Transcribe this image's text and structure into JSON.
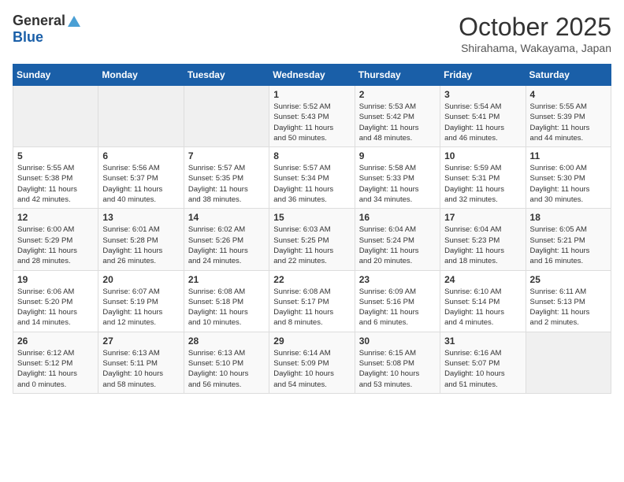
{
  "logo": {
    "general": "General",
    "blue": "Blue"
  },
  "title": "October 2025",
  "location": "Shirahama, Wakayama, Japan",
  "days_of_week": [
    "Sunday",
    "Monday",
    "Tuesday",
    "Wednesday",
    "Thursday",
    "Friday",
    "Saturday"
  ],
  "weeks": [
    [
      {
        "day": "",
        "info": ""
      },
      {
        "day": "",
        "info": ""
      },
      {
        "day": "",
        "info": ""
      },
      {
        "day": "1",
        "info": "Sunrise: 5:52 AM\nSunset: 5:43 PM\nDaylight: 11 hours\nand 50 minutes."
      },
      {
        "day": "2",
        "info": "Sunrise: 5:53 AM\nSunset: 5:42 PM\nDaylight: 11 hours\nand 48 minutes."
      },
      {
        "day": "3",
        "info": "Sunrise: 5:54 AM\nSunset: 5:41 PM\nDaylight: 11 hours\nand 46 minutes."
      },
      {
        "day": "4",
        "info": "Sunrise: 5:55 AM\nSunset: 5:39 PM\nDaylight: 11 hours\nand 44 minutes."
      }
    ],
    [
      {
        "day": "5",
        "info": "Sunrise: 5:55 AM\nSunset: 5:38 PM\nDaylight: 11 hours\nand 42 minutes."
      },
      {
        "day": "6",
        "info": "Sunrise: 5:56 AM\nSunset: 5:37 PM\nDaylight: 11 hours\nand 40 minutes."
      },
      {
        "day": "7",
        "info": "Sunrise: 5:57 AM\nSunset: 5:35 PM\nDaylight: 11 hours\nand 38 minutes."
      },
      {
        "day": "8",
        "info": "Sunrise: 5:57 AM\nSunset: 5:34 PM\nDaylight: 11 hours\nand 36 minutes."
      },
      {
        "day": "9",
        "info": "Sunrise: 5:58 AM\nSunset: 5:33 PM\nDaylight: 11 hours\nand 34 minutes."
      },
      {
        "day": "10",
        "info": "Sunrise: 5:59 AM\nSunset: 5:31 PM\nDaylight: 11 hours\nand 32 minutes."
      },
      {
        "day": "11",
        "info": "Sunrise: 6:00 AM\nSunset: 5:30 PM\nDaylight: 11 hours\nand 30 minutes."
      }
    ],
    [
      {
        "day": "12",
        "info": "Sunrise: 6:00 AM\nSunset: 5:29 PM\nDaylight: 11 hours\nand 28 minutes."
      },
      {
        "day": "13",
        "info": "Sunrise: 6:01 AM\nSunset: 5:28 PM\nDaylight: 11 hours\nand 26 minutes."
      },
      {
        "day": "14",
        "info": "Sunrise: 6:02 AM\nSunset: 5:26 PM\nDaylight: 11 hours\nand 24 minutes."
      },
      {
        "day": "15",
        "info": "Sunrise: 6:03 AM\nSunset: 5:25 PM\nDaylight: 11 hours\nand 22 minutes."
      },
      {
        "day": "16",
        "info": "Sunrise: 6:04 AM\nSunset: 5:24 PM\nDaylight: 11 hours\nand 20 minutes."
      },
      {
        "day": "17",
        "info": "Sunrise: 6:04 AM\nSunset: 5:23 PM\nDaylight: 11 hours\nand 18 minutes."
      },
      {
        "day": "18",
        "info": "Sunrise: 6:05 AM\nSunset: 5:21 PM\nDaylight: 11 hours\nand 16 minutes."
      }
    ],
    [
      {
        "day": "19",
        "info": "Sunrise: 6:06 AM\nSunset: 5:20 PM\nDaylight: 11 hours\nand 14 minutes."
      },
      {
        "day": "20",
        "info": "Sunrise: 6:07 AM\nSunset: 5:19 PM\nDaylight: 11 hours\nand 12 minutes."
      },
      {
        "day": "21",
        "info": "Sunrise: 6:08 AM\nSunset: 5:18 PM\nDaylight: 11 hours\nand 10 minutes."
      },
      {
        "day": "22",
        "info": "Sunrise: 6:08 AM\nSunset: 5:17 PM\nDaylight: 11 hours\nand 8 minutes."
      },
      {
        "day": "23",
        "info": "Sunrise: 6:09 AM\nSunset: 5:16 PM\nDaylight: 11 hours\nand 6 minutes."
      },
      {
        "day": "24",
        "info": "Sunrise: 6:10 AM\nSunset: 5:14 PM\nDaylight: 11 hours\nand 4 minutes."
      },
      {
        "day": "25",
        "info": "Sunrise: 6:11 AM\nSunset: 5:13 PM\nDaylight: 11 hours\nand 2 minutes."
      }
    ],
    [
      {
        "day": "26",
        "info": "Sunrise: 6:12 AM\nSunset: 5:12 PM\nDaylight: 11 hours\nand 0 minutes."
      },
      {
        "day": "27",
        "info": "Sunrise: 6:13 AM\nSunset: 5:11 PM\nDaylight: 10 hours\nand 58 minutes."
      },
      {
        "day": "28",
        "info": "Sunrise: 6:13 AM\nSunset: 5:10 PM\nDaylight: 10 hours\nand 56 minutes."
      },
      {
        "day": "29",
        "info": "Sunrise: 6:14 AM\nSunset: 5:09 PM\nDaylight: 10 hours\nand 54 minutes."
      },
      {
        "day": "30",
        "info": "Sunrise: 6:15 AM\nSunset: 5:08 PM\nDaylight: 10 hours\nand 53 minutes."
      },
      {
        "day": "31",
        "info": "Sunrise: 6:16 AM\nSunset: 5:07 PM\nDaylight: 10 hours\nand 51 minutes."
      },
      {
        "day": "",
        "info": ""
      }
    ]
  ]
}
